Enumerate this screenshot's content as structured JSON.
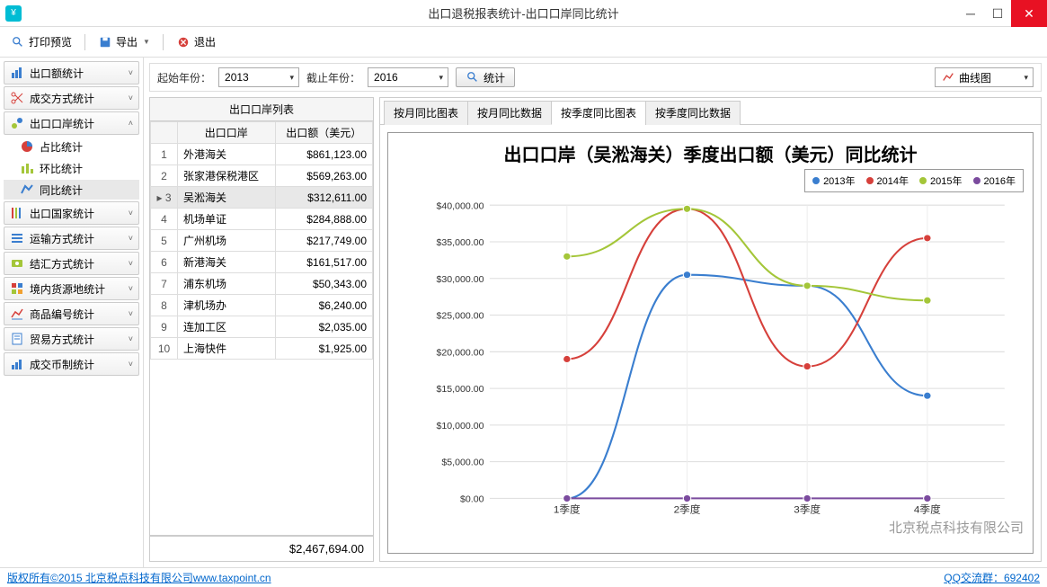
{
  "window": {
    "title": "出口退税报表统计-出口口岸同比统计"
  },
  "toolbar": {
    "print_preview": "打印预览",
    "export": "导出",
    "exit": "退出"
  },
  "sidebar": {
    "groups": [
      {
        "label": "出口额统计",
        "icon": "chart"
      },
      {
        "label": "成交方式统计",
        "icon": "scissors"
      },
      {
        "label": "出口口岸统计",
        "icon": "port",
        "expanded": true,
        "subs": [
          {
            "label": "占比统计",
            "icon": "pie"
          },
          {
            "label": "环比统计",
            "icon": "bar"
          },
          {
            "label": "同比统计",
            "icon": "line",
            "active": true
          }
        ]
      },
      {
        "label": "出口国家统计",
        "icon": "bars"
      },
      {
        "label": "运输方式统计",
        "icon": "list"
      },
      {
        "label": "结汇方式统计",
        "icon": "money"
      },
      {
        "label": "境内货源地统计",
        "icon": "grid"
      },
      {
        "label": "商品编号统计",
        "icon": "code"
      },
      {
        "label": "贸易方式统计",
        "icon": "doc"
      },
      {
        "label": "成交币制统计",
        "icon": "currency"
      }
    ]
  },
  "filters": {
    "start_year_label": "起始年份：",
    "start_year": "2013",
    "end_year_label": "截止年份：",
    "end_year": "2016",
    "stat_btn": "统计",
    "chart_type": "曲线图"
  },
  "table": {
    "title": "出口口岸列表",
    "cols": [
      "",
      "出口口岸",
      "出口额（美元）"
    ],
    "rows": [
      {
        "idx": 1,
        "name": "外港海关",
        "amount": "$861,123.00"
      },
      {
        "idx": 2,
        "name": "张家港保税港区",
        "amount": "$569,263.00"
      },
      {
        "idx": 3,
        "name": "吴淞海关",
        "amount": "$312,611.00",
        "selected": true
      },
      {
        "idx": 4,
        "name": "机场单证",
        "amount": "$284,888.00"
      },
      {
        "idx": 5,
        "name": "广州机场",
        "amount": "$217,749.00"
      },
      {
        "idx": 6,
        "name": "新港海关",
        "amount": "$161,517.00"
      },
      {
        "idx": 7,
        "name": "浦东机场",
        "amount": "$50,343.00"
      },
      {
        "idx": 8,
        "name": "津机场办",
        "amount": "$6,240.00"
      },
      {
        "idx": 9,
        "name": "连加工区",
        "amount": "$2,035.00"
      },
      {
        "idx": 10,
        "name": "上海快件",
        "amount": "$1,925.00"
      }
    ],
    "total": "$2,467,694.00"
  },
  "chart_tabs": [
    "按月同比图表",
    "按月同比数据",
    "按季度同比图表",
    "按季度同比数据"
  ],
  "chart_tab_active": 2,
  "chart_data": {
    "type": "line",
    "title": "出口口岸（吴淞海关）季度出口额（美元）同比统计",
    "categories": [
      "1季度",
      "2季度",
      "3季度",
      "4季度"
    ],
    "ylabel": "",
    "ylim": [
      0,
      40000
    ],
    "yticks": [
      "$0.00",
      "$5,000.00",
      "$10,000.00",
      "$15,000.00",
      "$20,000.00",
      "$25,000.00",
      "$30,000.00",
      "$35,000.00",
      "$40,000.00"
    ],
    "series": [
      {
        "name": "2013年",
        "color": "#3a7ecf",
        "values": [
          0,
          30500,
          29000,
          14000
        ]
      },
      {
        "name": "2014年",
        "color": "#d6403b",
        "values": [
          19000,
          39500,
          18000,
          35500
        ]
      },
      {
        "name": "2015年",
        "color": "#a4c639",
        "values": [
          33000,
          39500,
          29000,
          27000
        ]
      },
      {
        "name": "2016年",
        "color": "#7b4b9e",
        "values": [
          0,
          0,
          0,
          0
        ]
      }
    ],
    "watermark": "北京税点科技有限公司"
  },
  "statusbar": {
    "copyright": "版权所有©2015 北京税点科技有限公司www.taxpoint.cn",
    "qq_label": "QQ交流群：",
    "qq_num": "692402"
  }
}
